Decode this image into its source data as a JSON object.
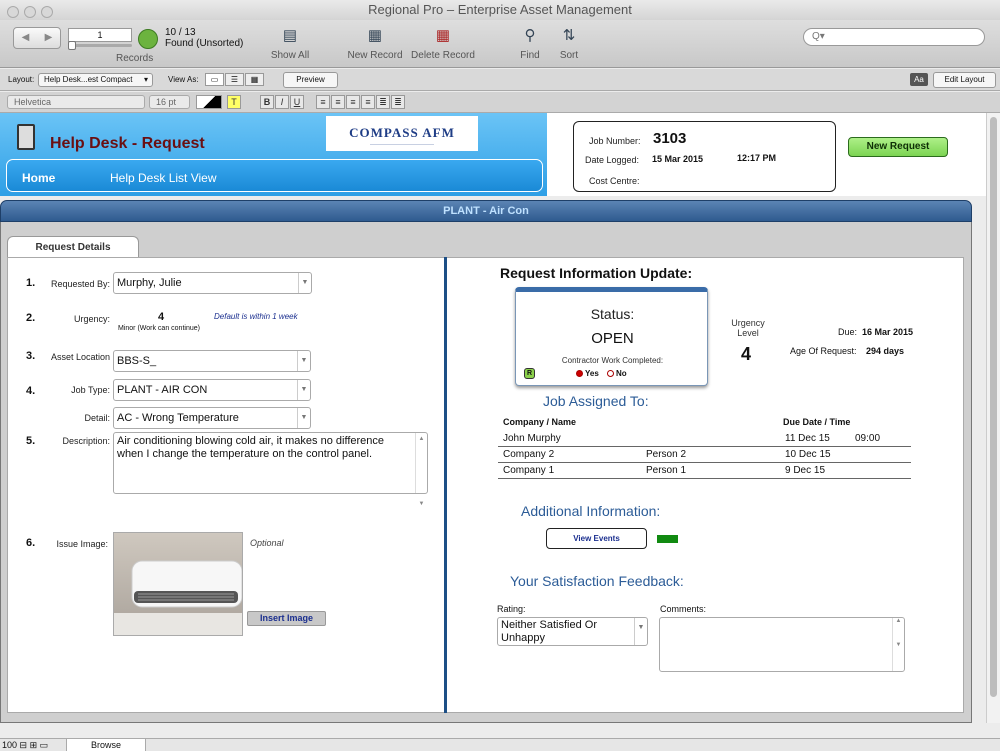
{
  "window": {
    "title": "Regional Pro – Enterprise Asset Management"
  },
  "toolbar": {
    "record_number": "1",
    "records_label": "Records",
    "found_count": "10 / 13",
    "found_label": "Found (Unsorted)",
    "show_all": "Show All",
    "new_record": "New Record",
    "delete_record": "Delete Record",
    "find": "Find",
    "sort": "Sort",
    "search_placeholder": "Q▾"
  },
  "layoutbar": {
    "layout_label": "Layout:",
    "layout_value": "Help Desk...est Compact",
    "view_as_label": "View As:",
    "preview": "Preview",
    "aa": "Aa",
    "edit_layout": "Edit Layout"
  },
  "formatbar": {
    "font": "Helvetica",
    "size": "16 pt",
    "bold": "B",
    "italic": "I",
    "underline": "U"
  },
  "header": {
    "page_title": "Help Desk - Request",
    "logo_text": "COMPASS AFM",
    "nav_home": "Home",
    "nav_list": "Help Desk List View",
    "job_number_label": "Job Number:",
    "job_number": "3103",
    "date_logged_label": "Date Logged:",
    "date_logged": "15 Mar 2015",
    "time_logged": "12:17 PM",
    "cost_centre_label": "Cost Centre:",
    "new_request": "New Request"
  },
  "section_title": "PLANT - Air Con",
  "tab_label": "Request Details",
  "form": {
    "requested_by_label": "Requested By:",
    "requested_by": "Murphy, Julie",
    "urgency_label": "Urgency:",
    "urgency_value": "4",
    "urgency_desc": "Minor (Work can continue)",
    "urgency_note": "Default is within 1 week",
    "asset_location_label": "Asset Location",
    "asset_location": "BBS-S_",
    "job_type_label": "Job Type:",
    "job_type": "PLANT - AIR CON",
    "detail_label": "Detail:",
    "detail": "AC - Wrong Temperature",
    "description_label": "Description:",
    "description": "Air conditioning blowing cold air, it makes no difference when I change the temperature on the control panel.",
    "issue_image_label": "Issue Image:",
    "optional": "Optional",
    "insert_image": "Insert Image",
    "steps": [
      "1.",
      "2.",
      "3.",
      "4.",
      "5.",
      "6."
    ]
  },
  "request_info": {
    "title": "Request Information Update:",
    "status_label": "Status:",
    "status_value": "OPEN",
    "contractor_label": "Contractor Work Completed:",
    "yes": "Yes",
    "no": "No",
    "r_badge": "R",
    "urgency_level_label": "Urgency Level",
    "urgency_level": "4",
    "due_label": "Due:",
    "due_value": "16 Mar 2015",
    "age_label": "Age Of Request:",
    "age_value": "294 days"
  },
  "job_assigned": {
    "title": "Job Assigned To:",
    "col_company": "Company / Name",
    "col_due": "Due Date  /  Time",
    "rows": [
      {
        "company": "John Murphy",
        "person": "",
        "due_date": "11 Dec 15",
        "time": "09:00"
      },
      {
        "company": "Company 2",
        "person": "Person 2",
        "due_date": "10 Dec 15",
        "time": ""
      },
      {
        "company": "Company 1",
        "person": "Person 1",
        "due_date": "9 Dec 15",
        "time": ""
      }
    ]
  },
  "additional": {
    "title": "Additional Information:",
    "view_events": "View Events"
  },
  "feedback": {
    "title": "Your Satisfaction Feedback:",
    "rating_label": "Rating:",
    "rating_value": "Neither Satisfied Or Unhappy",
    "comments_label": "Comments:"
  },
  "statusbar": {
    "zoom": "100",
    "mode": "Browse"
  }
}
